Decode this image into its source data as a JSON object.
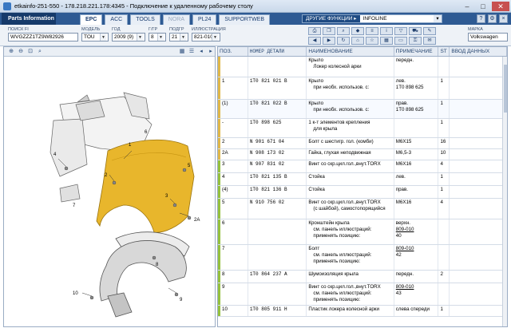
{
  "window": {
    "title": "etkainfo-251-550 - 178.218.221.178:4345 - Подключение к удаленному рабочему столу"
  },
  "app": {
    "brand": "Parts Information",
    "tabs": [
      {
        "label": "EPC"
      },
      {
        "label": "ACC"
      },
      {
        "label": "TOOLS"
      },
      {
        "label": "NORA"
      },
      {
        "label": "PL24"
      },
      {
        "label": "SUPPORTWEB"
      }
    ],
    "functions_label": "ДРУГИЕ ФУНКЦИИ",
    "functions_value": "INFOLINE"
  },
  "filters": {
    "vin": {
      "label": "ПОИСК FI",
      "value": "WVGZZZ1TZ9W82926"
    },
    "model": {
      "label": "МОДЕЛЬ",
      "value": "TOU"
    },
    "year": {
      "label": "ГОД",
      "value": "2009 (9)"
    },
    "group": {
      "label": "Г/ГР",
      "value": "8"
    },
    "subgroup": {
      "label": "ПОДГР",
      "value": "21"
    },
    "illustration": {
      "label": "ИЛЛЮСТРАЦИЯ",
      "value": "821-010"
    },
    "brand": {
      "label": "МАРКА",
      "value": "Volkswagen"
    }
  },
  "table": {
    "headers": {
      "pos": "ПОЗ.",
      "part": "НОМЕР ДЕТАЛИ",
      "name": "НАИМЕНОВАНИЕ",
      "note": "ПРИМЕЧАНИЕ",
      "st": "ST",
      "input": "ВВОД ДАННЫХ"
    },
    "rows": [
      {
        "pos": "",
        "part": "",
        "name": [
          "Крыло",
          "Локер колесной арки"
        ],
        "note": [
          "передн."
        ],
        "st": "",
        "h": 26
      },
      {
        "pos": "1",
        "part": "1T0 821 021 B",
        "name": [
          "Крыло",
          "при необх. использов. с:"
        ],
        "note": [
          "лев.",
          "1T0 898 625"
        ],
        "st": "1",
        "h": 28
      },
      {
        "pos": "(1)",
        "part": "1T0 821 022 B",
        "name": [
          "Крыло",
          "при необх. использов. с:"
        ],
        "note": [
          "прав.",
          "1T0 898 625"
        ],
        "st": "1",
        "h": 24
      },
      {
        "pos": "-",
        "part": "1T0 898 625",
        "name": [
          "1 к-т элементов крепления",
          "для крыла"
        ],
        "note": [],
        "st": "1",
        "h": 24
      },
      {
        "pos": "2",
        "part": "N  901 671 04",
        "name": [
          "Болт с шестигр. гол. (комби)"
        ],
        "note": [
          "M6X15"
        ],
        "st": "16",
        "h": 14
      },
      {
        "pos": "2A",
        "part": "N  908 173 02",
        "name": [
          "Гайка, глухая неподвижная"
        ],
        "note": [
          "M6,5-3"
        ],
        "st": "10",
        "h": 14
      },
      {
        "pos": "3",
        "part": "N  907 831 02",
        "name": [
          "Винт со скр.цил.гол.,внут.TORX"
        ],
        "note": [
          "M6X16"
        ],
        "st": "4",
        "h": 16
      },
      {
        "pos": "4",
        "part": "1T0 821 135 B",
        "name": [
          "Стойка"
        ],
        "note": [
          "лев."
        ],
        "st": "1",
        "h": 16
      },
      {
        "pos": "(4)",
        "part": "1T0 821 136 B",
        "name": [
          "Стойка"
        ],
        "note": [
          "прав."
        ],
        "st": "1",
        "h": 16
      },
      {
        "pos": "5",
        "part": "N  910 756 02",
        "name": [
          "Винт со скр.цил.гол.,внут.TORX",
          "(с шайбой), самостопорящийся"
        ],
        "note": [
          "M6X16"
        ],
        "st": "4",
        "h": 26
      },
      {
        "pos": "6",
        "part": "",
        "name": [
          "Кронштейн крыла",
          "см. панель иллюстраций:",
          "применять позицию:"
        ],
        "note": [
          "верхн.",
          "809-010",
          "40"
        ],
        "st": "",
        "h": 32
      },
      {
        "pos": "7",
        "part": "",
        "name": [
          "Болт",
          "см. панель иллюстраций:",
          "применять позицию:"
        ],
        "note": [
          "",
          "809-010",
          "42"
        ],
        "st": "",
        "h": 32
      },
      {
        "pos": "8",
        "part": "1T0 864 237 A",
        "name": [
          "Шумоизоляция крыла"
        ],
        "note": [
          "передн."
        ],
        "st": "2",
        "h": 16
      },
      {
        "pos": "9",
        "part": "",
        "name": [
          "Винт со скр.цил.гол.,внут.TORX",
          "см. панель иллюстраций:",
          "применять позицию:"
        ],
        "note": [
          "",
          "809-010",
          "43"
        ],
        "st": "",
        "h": 28
      },
      {
        "pos": "10",
        "part": "1T0 805 911 H",
        "name": [
          "Пластик локера колесной арки"
        ],
        "note": [
          "слева спереди"
        ],
        "st": "1",
        "h": 14
      }
    ]
  },
  "callouts": [
    "1",
    "2",
    "2A",
    "3",
    "4",
    "5",
    "6",
    "7",
    "8",
    "9",
    "10"
  ]
}
